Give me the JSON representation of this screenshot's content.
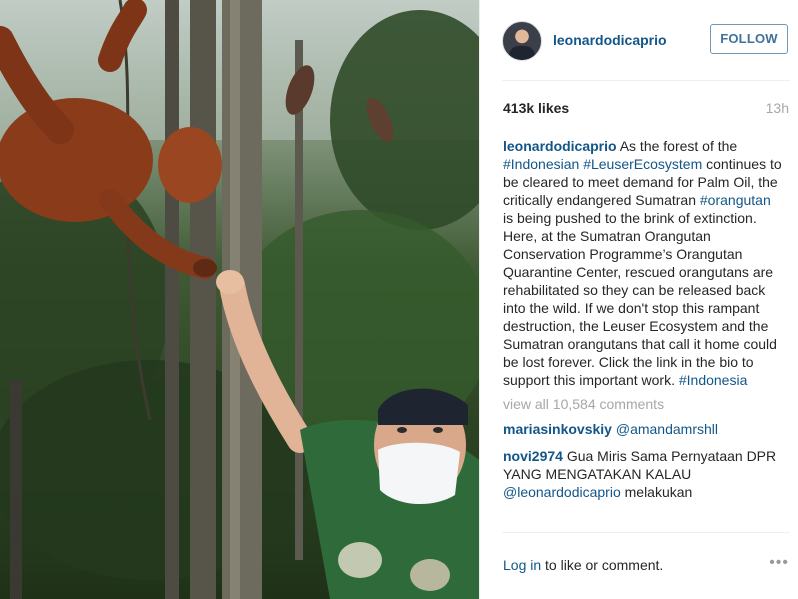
{
  "post": {
    "username": "leonardodicaprio",
    "follow_label": "FOLLOW",
    "likes": "413k likes",
    "time": "13h"
  },
  "caption": {
    "username": "leonardodicaprio",
    "text_1": " As the forest of the ",
    "tag_1": "#Indonesian",
    "text_2": " ",
    "tag_2": "#LeuserEcosystem",
    "text_3": " continues to be cleared to meet demand for Palm Oil, the critically endangered Sumatran ",
    "tag_3": "#orangutan",
    "text_4": " is being pushed to the brink of extinction. Here, at the Sumatran Orangutan Conservation Programme’s Orangutan Quarantine Center, rescued orangutans are rehabilitated so they can be released back into the wild. If we don't stop this rampant destruction, the Leuser Ecosystem and the Sumatran orangutans that call it home could be lost forever. Click the link in the bio to support this important work. ",
    "tag_4": "#Indonesia"
  },
  "view_all": "view all 10,584 comments",
  "comments": [
    {
      "username": "mariasinkovskiy",
      "mention": "@amandamrshll",
      "text": ""
    },
    {
      "username": "novi2974",
      "text": " Gua Miris Sama Pernyataan DPR YANG MENGATAKAN KALAU ",
      "mention": "@leonardodicaprio",
      "text_after": " melakukan"
    }
  ],
  "footer": {
    "login_link": "Log in",
    "login_text": " to like or comment.",
    "more_icon": "•••"
  },
  "colors": {
    "username": "#125688",
    "follow_border": "#6f97b6",
    "muted": "#a5a7aa"
  }
}
